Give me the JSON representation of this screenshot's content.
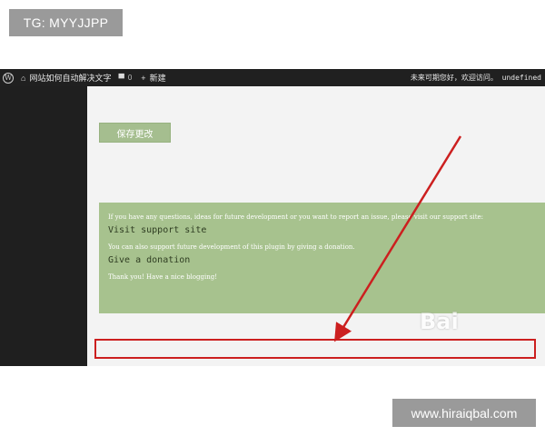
{
  "overlay": {
    "tg_label": "TG: MYYJJPP",
    "site_url": "www.hiraiqbal.com",
    "watermark_text": "Bai"
  },
  "adminbar": {
    "site_name": "网站如何自动解决文字",
    "comments_count": "0",
    "new_label": "新建",
    "greeting": "未来可期您好，欢迎访问。 undefined",
    "icons": [
      "wordpress-logo",
      "home-icon",
      "comment-icon",
      "plus-icon"
    ]
  },
  "main": {
    "save_button_label": "保存更改",
    "support": {
      "intro": "If you have any questions, ideas for future development or you want to report an issue, please visit our support site:",
      "visit_link": "Visit support site",
      "donate_text": "You can also support future development of this plugin by giving a donation.",
      "donate_link": "Give a donation",
      "thanks": "Thank you! Have a nice blogging!"
    }
  },
  "colors": {
    "adminbar_bg": "#202020",
    "sidebar_bg": "#1f1f1f",
    "accent_green": "#a7c28e",
    "highlight_red": "#cc1f1f"
  }
}
